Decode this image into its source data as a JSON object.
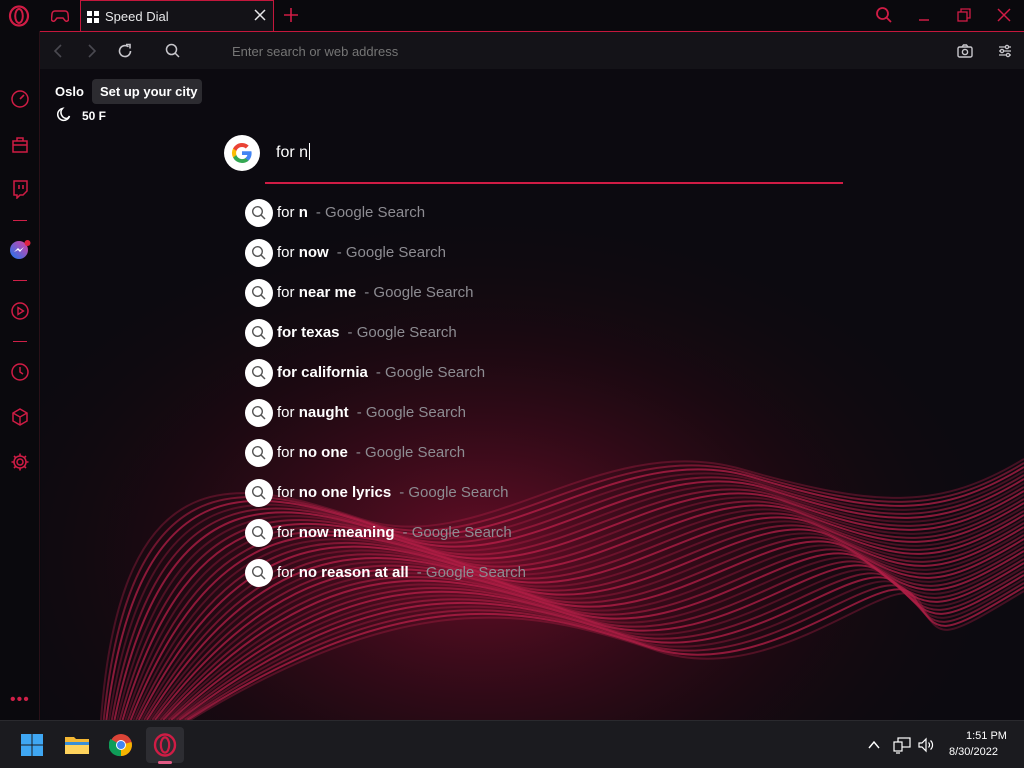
{
  "browser": {
    "tab": {
      "title": "Speed Dial"
    },
    "address": {
      "placeholder": "Enter search or web address"
    }
  },
  "weather": {
    "city": "Oslo",
    "tooltip": "Set up your city",
    "temperature": "50 F"
  },
  "search": {
    "query": "for n",
    "suggestion_source": "- Google Search",
    "suggestions": [
      {
        "prefix": "for ",
        "completion": "n"
      },
      {
        "prefix": "for ",
        "completion": "now"
      },
      {
        "prefix": "for ",
        "completion": "near me"
      },
      {
        "prefix": "",
        "completion": "for texas"
      },
      {
        "prefix": "",
        "completion": "for california"
      },
      {
        "prefix": "for ",
        "completion": "naught"
      },
      {
        "prefix": "for ",
        "completion": "no one"
      },
      {
        "prefix": "for ",
        "completion": "no one lyrics"
      },
      {
        "prefix": "for ",
        "completion": "now meaning"
      },
      {
        "prefix": "for ",
        "completion": "no reason at all"
      }
    ]
  },
  "taskbar": {
    "time": "1:51 PM",
    "date": "8/30/2022"
  },
  "colors": {
    "accent": "#d01c45",
    "background": "#0b0a0f"
  }
}
